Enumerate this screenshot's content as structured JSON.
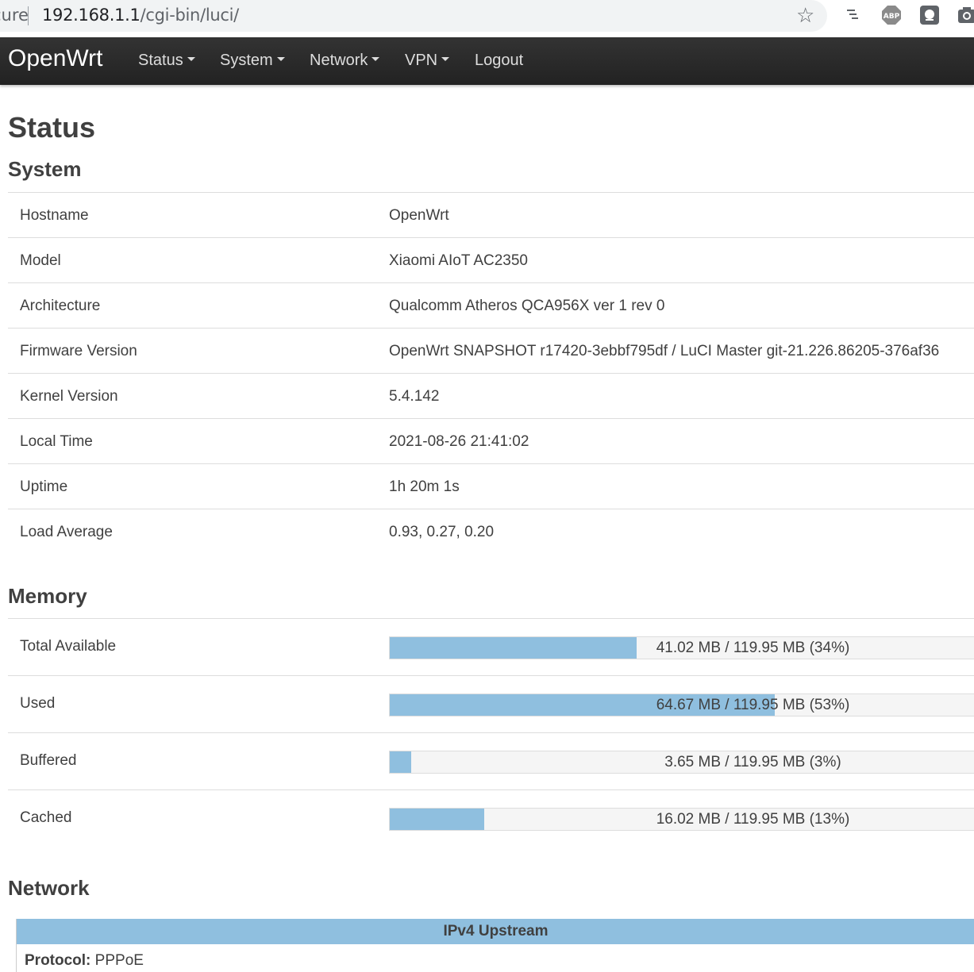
{
  "browser": {
    "url_prefix": "cure",
    "url_host": "192.168.1.1",
    "url_path": "/cgi-bin/luci/"
  },
  "header": {
    "brand": "OpenWrt",
    "menu": [
      {
        "label": "Status",
        "dropdown": true
      },
      {
        "label": "System",
        "dropdown": true
      },
      {
        "label": "Network",
        "dropdown": true
      },
      {
        "label": "VPN",
        "dropdown": true
      },
      {
        "label": "Logout",
        "dropdown": false
      }
    ]
  },
  "page": {
    "title": "Status"
  },
  "system": {
    "title": "System",
    "rows": [
      {
        "key": "Hostname",
        "value": "OpenWrt"
      },
      {
        "key": "Model",
        "value": "Xiaomi AIoT AC2350"
      },
      {
        "key": "Architecture",
        "value": "Qualcomm Atheros QCA956X ver 1 rev 0"
      },
      {
        "key": "Firmware Version",
        "value": "OpenWrt SNAPSHOT r17420-3ebbf795df / LuCI Master git-21.226.86205-376af36"
      },
      {
        "key": "Kernel Version",
        "value": "5.4.142"
      },
      {
        "key": "Local Time",
        "value": "2021-08-26 21:41:02"
      },
      {
        "key": "Uptime",
        "value": "1h 20m 1s"
      },
      {
        "key": "Load Average",
        "value": "0.93, 0.27, 0.20"
      }
    ]
  },
  "memory": {
    "title": "Memory",
    "rows": [
      {
        "key": "Total Available",
        "text": "41.02 MB / 119.95 MB (34%)",
        "percent": 34
      },
      {
        "key": "Used",
        "text": "64.67 MB / 119.95 MB (53%)",
        "percent": 53
      },
      {
        "key": "Buffered",
        "text": "3.65 MB / 119.95 MB (3%)",
        "percent": 3
      },
      {
        "key": "Cached",
        "text": "16.02 MB / 119.95 MB (13%)",
        "percent": 13
      }
    ]
  },
  "network": {
    "title": "Network",
    "upstream_heading": "IPv4 Upstream",
    "protocol_label": "Protocol:",
    "protocol_value": "PPPoE"
  },
  "colors": {
    "bar_fill": "#8fbfdf",
    "navbar": "#222222"
  }
}
